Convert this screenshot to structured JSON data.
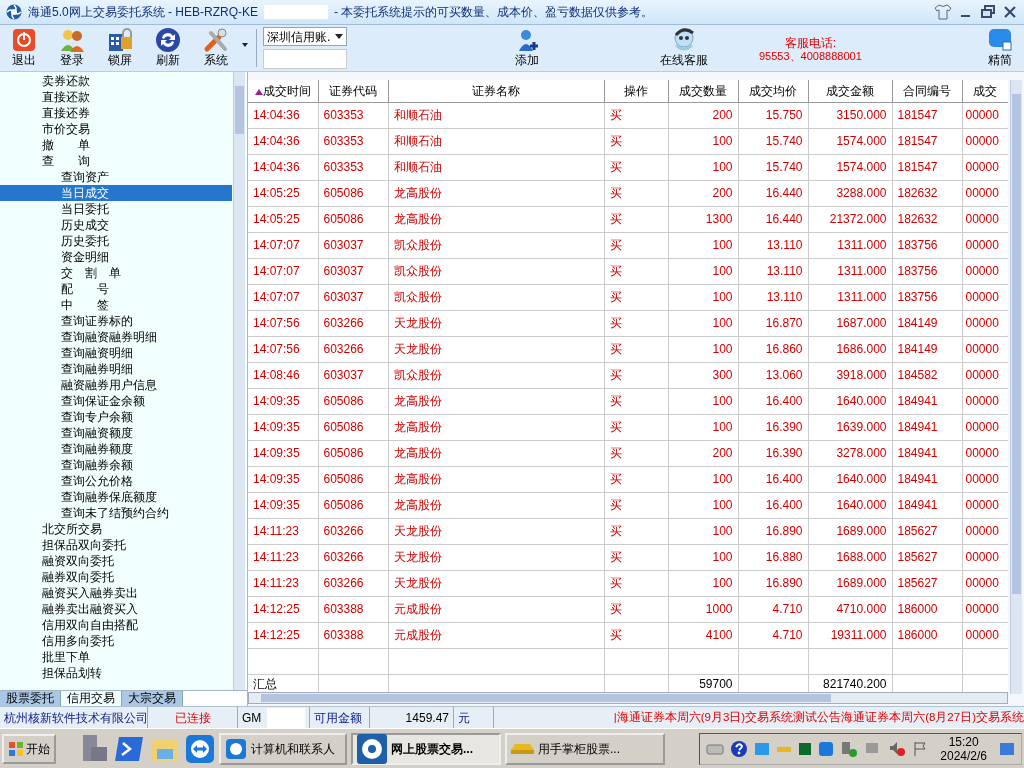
{
  "window": {
    "title": "海通5.0网上交易委托系统 - HEB-RZRQ-KE",
    "title_suffix": "- 本委托系统提示的可买数量、成本价、盈亏数据仅供参考。"
  },
  "toolbar": {
    "buttons": [
      {
        "label": "退出",
        "kind": "exit"
      },
      {
        "label": "登录",
        "kind": "login"
      },
      {
        "label": "锁屏",
        "kind": "lock"
      },
      {
        "label": "刷新",
        "kind": "refresh"
      },
      {
        "label": "系统",
        "kind": "system"
      }
    ],
    "account_select": {
      "value": "深圳信用账."
    },
    "add": {
      "label": "添加"
    },
    "online_service": {
      "label": "在线客服"
    },
    "hotline": {
      "label": "客服电话:",
      "numbers": "95553、4008888001"
    },
    "compact": {
      "label": "精简"
    }
  },
  "sidebar": {
    "items": [
      {
        "label": "卖券还款",
        "selected": false
      },
      {
        "label": "直接还款",
        "selected": false
      },
      {
        "label": "直接还券",
        "selected": false
      },
      {
        "label": "市价交易",
        "selected": false
      },
      {
        "label": "撤　　单",
        "selected": false
      },
      {
        "label": "查　　询",
        "selected": false,
        "children": [
          {
            "label": "查询资产",
            "selected": false
          },
          {
            "label": "当日成交",
            "selected": true
          },
          {
            "label": "当日委托",
            "selected": false
          },
          {
            "label": "历史成交",
            "selected": false
          },
          {
            "label": "历史委托",
            "selected": false
          },
          {
            "label": "资金明细",
            "selected": false
          },
          {
            "label": "交　割　单",
            "selected": false
          },
          {
            "label": "配　　号",
            "selected": false
          },
          {
            "label": "中　　签",
            "selected": false
          },
          {
            "label": "查询证券标的",
            "selected": false
          },
          {
            "label": "查询融资融券明细",
            "selected": false
          },
          {
            "label": "查询融资明细",
            "selected": false
          },
          {
            "label": "查询融券明细",
            "selected": false
          },
          {
            "label": "融资融券用户信息",
            "selected": false
          },
          {
            "label": "查询保证金余额",
            "selected": false
          },
          {
            "label": "查询专户余额",
            "selected": false
          },
          {
            "label": "查询融资额度",
            "selected": false
          },
          {
            "label": "查询融券额度",
            "selected": false
          },
          {
            "label": "查询融券余额",
            "selected": false
          },
          {
            "label": "查询公允价格",
            "selected": false
          },
          {
            "label": "查询融券保底额度",
            "selected": false
          },
          {
            "label": "查询未了结预约合约",
            "selected": false
          }
        ]
      },
      {
        "label": "北交所交易",
        "selected": false
      },
      {
        "label": "担保品双向委托",
        "selected": false
      },
      {
        "label": "融资双向委托",
        "selected": false
      },
      {
        "label": "融券双向委托",
        "selected": false
      },
      {
        "label": "融资买入融券卖出",
        "selected": false
      },
      {
        "label": "融券卖出融资买入",
        "selected": false
      },
      {
        "label": "信用双向自由搭配",
        "selected": false
      },
      {
        "label": "信用多向委托",
        "selected": false
      },
      {
        "label": "批里下单",
        "selected": false
      },
      {
        "label": "担保品划转",
        "selected": false
      }
    ],
    "tabs": [
      {
        "label": "股票委托",
        "selected": false
      },
      {
        "label": "信用交易",
        "selected": true
      },
      {
        "label": "大宗交易",
        "selected": false
      }
    ]
  },
  "table": {
    "columns": [
      {
        "label": "成交时间",
        "sorted": true
      },
      {
        "label": "证券代码",
        "sorted": false
      },
      {
        "label": "证券名称",
        "sorted": false
      },
      {
        "label": "操作",
        "sorted": false
      },
      {
        "label": "成交数量",
        "sorted": false
      },
      {
        "label": "成交均价",
        "sorted": false
      },
      {
        "label": "成交金额",
        "sorted": false
      },
      {
        "label": "合同编号",
        "sorted": false
      },
      {
        "label": "成交",
        "sorted": false
      }
    ],
    "rows": [
      [
        "14:04:36",
        "603353",
        "和顺石油",
        "买",
        "200",
        "15.750",
        "3150.000",
        "181547",
        "00000"
      ],
      [
        "14:04:36",
        "603353",
        "和顺石油",
        "买",
        "100",
        "15.740",
        "1574.000",
        "181547",
        "00000"
      ],
      [
        "14:04:36",
        "603353",
        "和顺石油",
        "买",
        "100",
        "15.740",
        "1574.000",
        "181547",
        "00000"
      ],
      [
        "14:05:25",
        "605086",
        "龙高股份",
        "买",
        "200",
        "16.440",
        "3288.000",
        "182632",
        "00000"
      ],
      [
        "14:05:25",
        "605086",
        "龙高股份",
        "买",
        "1300",
        "16.440",
        "21372.000",
        "182632",
        "00000"
      ],
      [
        "14:07:07",
        "603037",
        "凯众股份",
        "买",
        "100",
        "13.110",
        "1311.000",
        "183756",
        "00000"
      ],
      [
        "14:07:07",
        "603037",
        "凯众股份",
        "买",
        "100",
        "13.110",
        "1311.000",
        "183756",
        "00000"
      ],
      [
        "14:07:07",
        "603037",
        "凯众股份",
        "买",
        "100",
        "13.110",
        "1311.000",
        "183756",
        "00000"
      ],
      [
        "14:07:56",
        "603266",
        "天龙股份",
        "买",
        "100",
        "16.870",
        "1687.000",
        "184149",
        "00000"
      ],
      [
        "14:07:56",
        "603266",
        "天龙股份",
        "买",
        "100",
        "16.860",
        "1686.000",
        "184149",
        "00000"
      ],
      [
        "14:08:46",
        "603037",
        "凯众股份",
        "买",
        "300",
        "13.060",
        "3918.000",
        "184582",
        "00000"
      ],
      [
        "14:09:35",
        "605086",
        "龙高股份",
        "买",
        "100",
        "16.400",
        "1640.000",
        "184941",
        "00000"
      ],
      [
        "14:09:35",
        "605086",
        "龙高股份",
        "买",
        "100",
        "16.390",
        "1639.000",
        "184941",
        "00000"
      ],
      [
        "14:09:35",
        "605086",
        "龙高股份",
        "买",
        "200",
        "16.390",
        "3278.000",
        "184941",
        "00000"
      ],
      [
        "14:09:35",
        "605086",
        "龙高股份",
        "买",
        "100",
        "16.400",
        "1640.000",
        "184941",
        "00000"
      ],
      [
        "14:09:35",
        "605086",
        "龙高股份",
        "买",
        "100",
        "16.400",
        "1640.000",
        "184941",
        "00000"
      ],
      [
        "14:11:23",
        "603266",
        "天龙股份",
        "买",
        "100",
        "16.890",
        "1689.000",
        "185627",
        "00000"
      ],
      [
        "14:11:23",
        "603266",
        "天龙股份",
        "买",
        "100",
        "16.880",
        "1688.000",
        "185627",
        "00000"
      ],
      [
        "14:11:23",
        "603266",
        "天龙股份",
        "买",
        "100",
        "16.890",
        "1689.000",
        "185627",
        "00000"
      ],
      [
        "14:12:25",
        "603388",
        "元成股份",
        "买",
        "1000",
        "4.710",
        "4710.000",
        "186000",
        "00000"
      ],
      [
        "14:12:25",
        "603388",
        "元成股份",
        "买",
        "4100",
        "4.710",
        "19311.000",
        "186000",
        "00000"
      ]
    ],
    "summary": {
      "label": "汇总",
      "quantity": "59700",
      "amount": "821740.200"
    }
  },
  "status_bar": {
    "company": "杭州核新软件技术有限公司",
    "connection": "已连接",
    "connected": true,
    "account_prefix": "GM",
    "funds_label": "可用金额",
    "funds": "1459.47",
    "unit": "元",
    "notice": "|海通证券本周六(9月3日)交易系统测试公告海通证券本周六(8月27日)交易系统"
  },
  "taskbar": {
    "start": "开始",
    "tasks": [
      {
        "label": "计算机和联系人",
        "selected": false
      },
      {
        "label": "网上股票交易...",
        "selected": true
      },
      {
        "label": "用手掌柜股票...",
        "selected": false
      }
    ],
    "time": "15:20",
    "date": "2024/2/6"
  }
}
